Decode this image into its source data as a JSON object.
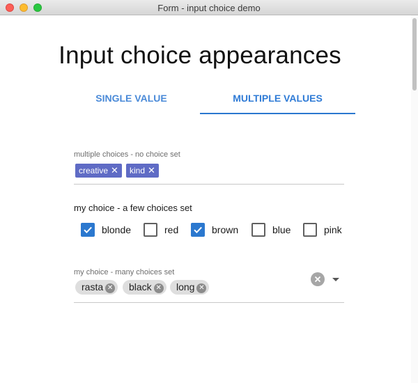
{
  "window": {
    "title": "Form - input choice demo"
  },
  "page": {
    "title": "Input choice appearances"
  },
  "tabs": [
    {
      "label": "SINGLE VALUE",
      "selected": false
    },
    {
      "label": "MULTIPLE VALUES",
      "selected": true
    }
  ],
  "field_multiple": {
    "label": "multiple choices - no choice set",
    "chips": [
      "creative",
      "kind"
    ],
    "chip_remove_glyph": "✕"
  },
  "field_few": {
    "label": "my choice - a few choices set",
    "options": [
      {
        "label": "blonde",
        "checked": true
      },
      {
        "label": "red",
        "checked": false
      },
      {
        "label": "brown",
        "checked": true
      },
      {
        "label": "blue",
        "checked": false
      },
      {
        "label": "pink",
        "checked": false
      }
    ]
  },
  "field_many": {
    "label": "my choice - many choices set",
    "chips": [
      "rasta",
      "black",
      "long"
    ],
    "chip_remove_glyph": "✕"
  },
  "colors": {
    "accent": "#2b78cf",
    "chip_blue": "#5f6bc5",
    "chip_gray": "#dedede"
  }
}
